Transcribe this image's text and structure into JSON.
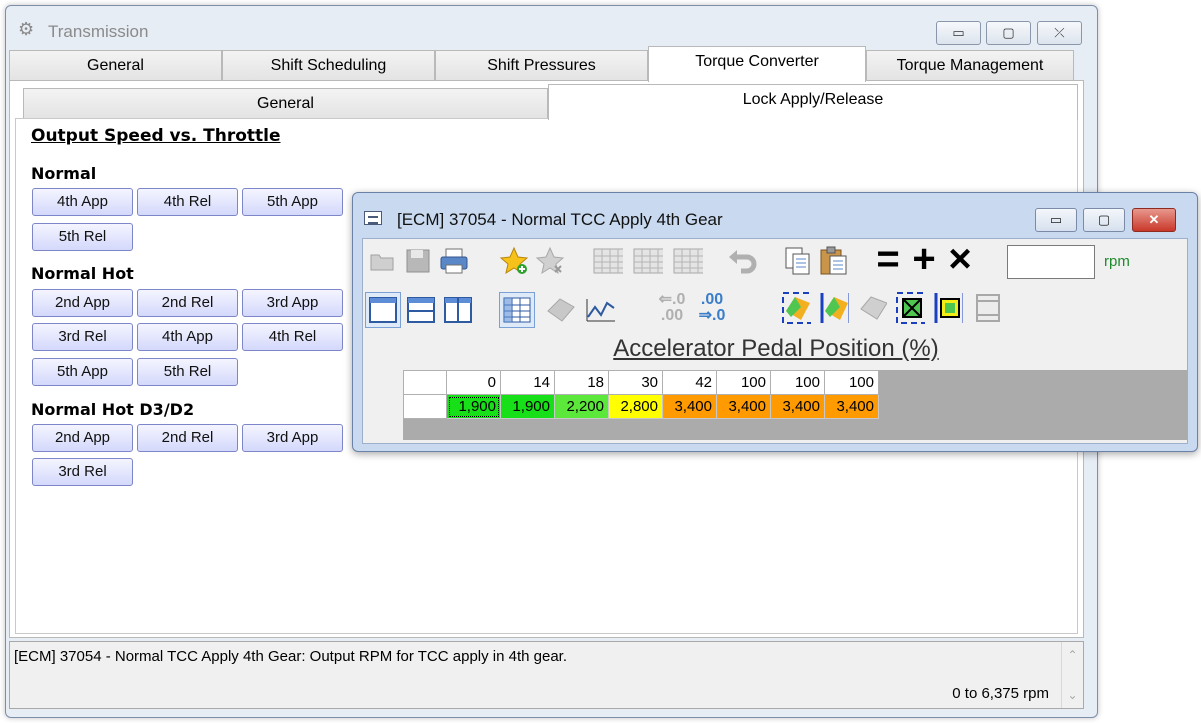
{
  "window": {
    "title": "Transmission",
    "title_icon": "gear-icon",
    "controls": {
      "minimize": "▭",
      "maximize": "▢",
      "close": "⤫"
    }
  },
  "tabs_main": [
    "General",
    "Shift Scheduling",
    "Shift Pressures",
    "Torque Converter",
    "Torque Management"
  ],
  "tabs_main_active": "Torque Converter",
  "tabs_sub": [
    "General",
    "Lock Apply/Release"
  ],
  "tabs_sub_active": "Lock Apply/Release",
  "section_title": "Output Speed vs. Throttle",
  "groups": [
    {
      "title": "Normal",
      "buttons": [
        "4th App",
        "4th Rel",
        "5th App",
        "5th Rel"
      ]
    },
    {
      "title": "Normal Hot",
      "buttons": [
        "2nd App",
        "2nd Rel",
        "3rd App",
        "3rd Rel",
        "4th App",
        "4th Rel",
        "5th App",
        "5th Rel"
      ]
    },
    {
      "title": "Normal Hot D3/D2",
      "buttons": [
        "2nd App",
        "2nd Rel",
        "3rd App",
        "3rd Rel"
      ]
    }
  ],
  "status": {
    "description": "[ECM] 37054 - Normal TCC Apply 4th Gear: Output RPM for TCC apply in 4th gear.",
    "range": "0 to 6,375 rpm"
  },
  "ecm_window": {
    "title": "[ECM] 37054 - Normal TCC Apply 4th Gear",
    "toolbar_row1": [
      "open-icon",
      "save-icon",
      "print-icon",
      "favorite-add-icon",
      "favorite-remove-icon",
      "table-icon",
      "table-icon-2",
      "table-icon-3",
      "undo-icon",
      "copy-icon",
      "paste-icon",
      "equals-icon",
      "plus-icon",
      "multiply-icon"
    ],
    "toolbar_row2": [
      "single-pane-icon",
      "horizontal-split-icon",
      "vertical-split-icon",
      "table-view-icon",
      "3d-view-icon",
      "line-chart-icon",
      "decrease-decimal-icon",
      "increase-decimal-icon",
      "smooth-icon",
      "interpolate-icon",
      "fill-icon",
      "select-cell-icon",
      "select-all-icon",
      "clear-icon"
    ],
    "decimal_text": {
      "dec_top": "⇐.0",
      "dec_bottom": ".00",
      "inc_top": ".00",
      "inc_bottom": "⇒.0"
    },
    "ops": {
      "equals": "=",
      "plus": "+",
      "multiply": "×"
    },
    "input_value": "",
    "unit": "rpm",
    "axis_title": "Accelerator Pedal Position (%)",
    "columns": [
      "0",
      "14",
      "18",
      "30",
      "42",
      "100",
      "100",
      "100"
    ],
    "values": [
      "1,900",
      "1,900",
      "2,200",
      "2,800",
      "3,400",
      "3,400",
      "3,400",
      "3,400"
    ],
    "value_colors": [
      "#18e018",
      "#18e018",
      "#5ce83a",
      "#ffff00",
      "#ff9a00",
      "#ff9a00",
      "#ff9a00",
      "#ff9a00"
    ]
  }
}
